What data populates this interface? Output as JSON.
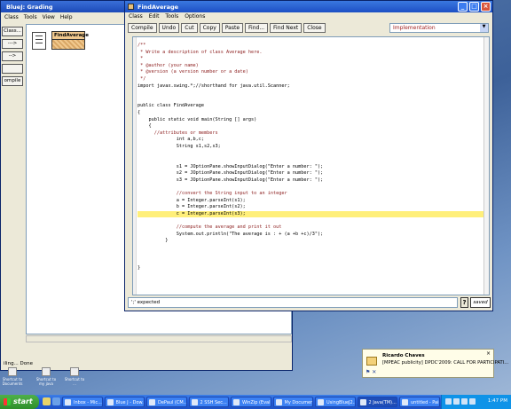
{
  "bluej": {
    "title": "BlueJ:  Grading",
    "menu": [
      "Class",
      "Tools",
      "View",
      "Help"
    ],
    "side_buttons": [
      "Class...",
      "--->",
      "-->",
      "",
      "ompile"
    ],
    "class_box": "FindAverage",
    "status": "iling... Done"
  },
  "desktop_icons": [
    "Shortcut to\nDocuments",
    "Shortcut to\nmy java",
    "Shortcut\nto ..."
  ],
  "editor": {
    "title": "FindAverage",
    "menu": [
      "Class",
      "Edit",
      "Tools",
      "Options"
    ],
    "toolbar": [
      "Compile",
      "Undo",
      "Cut",
      "Copy",
      "Paste",
      "Find...",
      "Find Next",
      "Close"
    ],
    "view_select": "Implementation",
    "code": [
      "/**",
      " * Write a description of class Average here.",
      " *",
      " * @author (your name)",
      " * @version (a version number or a date)",
      " */",
      "import javax.swing.*;//shorthand for java.util.Scanner;",
      "",
      "",
      "public class FindAverage",
      "{",
      "    public static void main(String [] args)",
      "    {",
      "      //attributes or members",
      "              int a,b,c;",
      "              String s1,s2,s3;",
      "",
      "",
      "              s1 = JOptionPane.showInputDialog(\"Enter a number: \");",
      "              s2 = JOptionPane.showInputDialog(\"Enter a number: \");",
      "              s3 = JOptionPane.showInputDialog(\"Enter a number: \");",
      "",
      "              //convert the String input to an integer",
      "              a = Integer.parseInt(s1);",
      "              b = Integer.parseInt(s2);",
      "              c = Integer.parseInt(s3);",
      "",
      "              //compute the average and print it out",
      "              System.out.println(\"The average is : + (a +b +c)/3\");",
      "          }",
      "",
      "",
      "",
      "}"
    ],
    "highlight_line": 25,
    "message": "';' expected",
    "help_label": "?",
    "saved_label": "saved"
  },
  "notification": {
    "sender": "Ricardo Chaves",
    "message": "[MPEAC publicity] DPDC'2009: CALL FOR PARTICIPATI..."
  },
  "taskbar": {
    "start": "start",
    "tasks": [
      "Inbox - Mic...",
      "Blue J - Dow...",
      "DePaul (CM...",
      "2 SSH Sec...",
      "WinZip (Eval...",
      "My Documents",
      "UsingBlueJ2...",
      "2 Java(TM)...",
      "untitled - Paint"
    ],
    "active_task": 7,
    "clock": "1:47 PM"
  }
}
